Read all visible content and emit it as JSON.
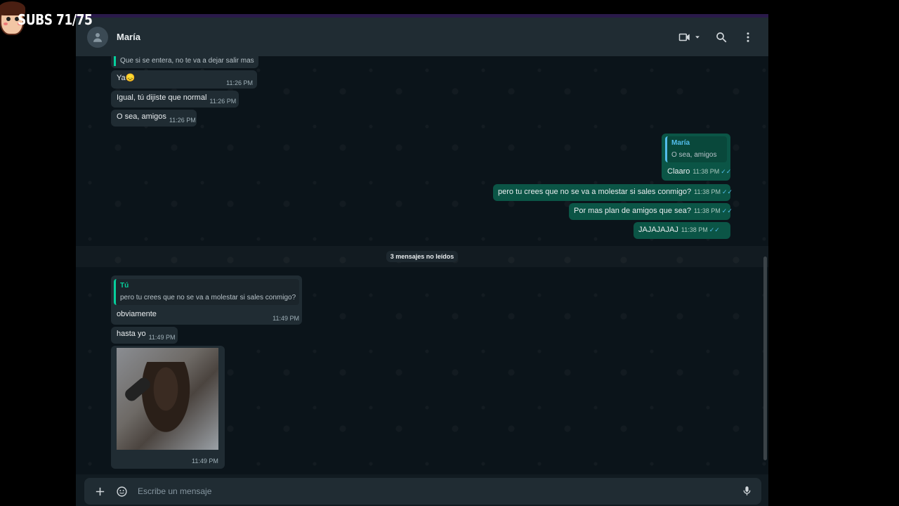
{
  "overlay": {
    "label": "SUBS 71/75"
  },
  "header": {
    "contact_name": "María"
  },
  "messages": {
    "m1": {
      "text": "Que si se entera, no te va a dejar salir mas"
    },
    "m2": {
      "text": "Ya",
      "emoji": "😞",
      "time": "11:26 PM"
    },
    "m3": {
      "text": "Igual, tú dijiste que normal",
      "time": "11:26 PM"
    },
    "m4": {
      "text": "O sea, amigos",
      "time": "11:26 PM"
    },
    "o1": {
      "quote_name": "María",
      "quote_text": "O sea, amigos",
      "text": "Claaro",
      "time": "11:38 PM"
    },
    "o2": {
      "text": "pero tu crees que no se va a molestar si sales conmigo?",
      "time": "11:38 PM"
    },
    "o3": {
      "text": "Por mas plan de amigos que sea?",
      "time": "11:38 PM"
    },
    "o4": {
      "text": "JAJAJAJAJ",
      "time": "11:38 PM"
    },
    "i1": {
      "quote_name": "Tú",
      "quote_text": "pero tu crees que no se va a molestar si sales conmigo?",
      "text": "obviamente",
      "time": "11:49 PM"
    },
    "i2": {
      "text": "hasta yo",
      "time": "11:49 PM"
    },
    "i3": {
      "time": "11:49 PM"
    }
  },
  "unread": {
    "label": "3 mensajes no leídos"
  },
  "composer": {
    "placeholder": "Escribe un mensaje"
  },
  "icons": {
    "video": "video-call-icon",
    "search": "search-icon",
    "menu": "kebab-menu-icon",
    "plus": "plus-icon",
    "sticker": "sticker-icon",
    "mic": "microphone-icon",
    "ticks": "read-receipt-icon"
  },
  "colors": {
    "incoming": "#202c33",
    "outgoing": "#0b5546",
    "accent": "#06cf9c",
    "quote_name_out": "#53bdeb"
  }
}
